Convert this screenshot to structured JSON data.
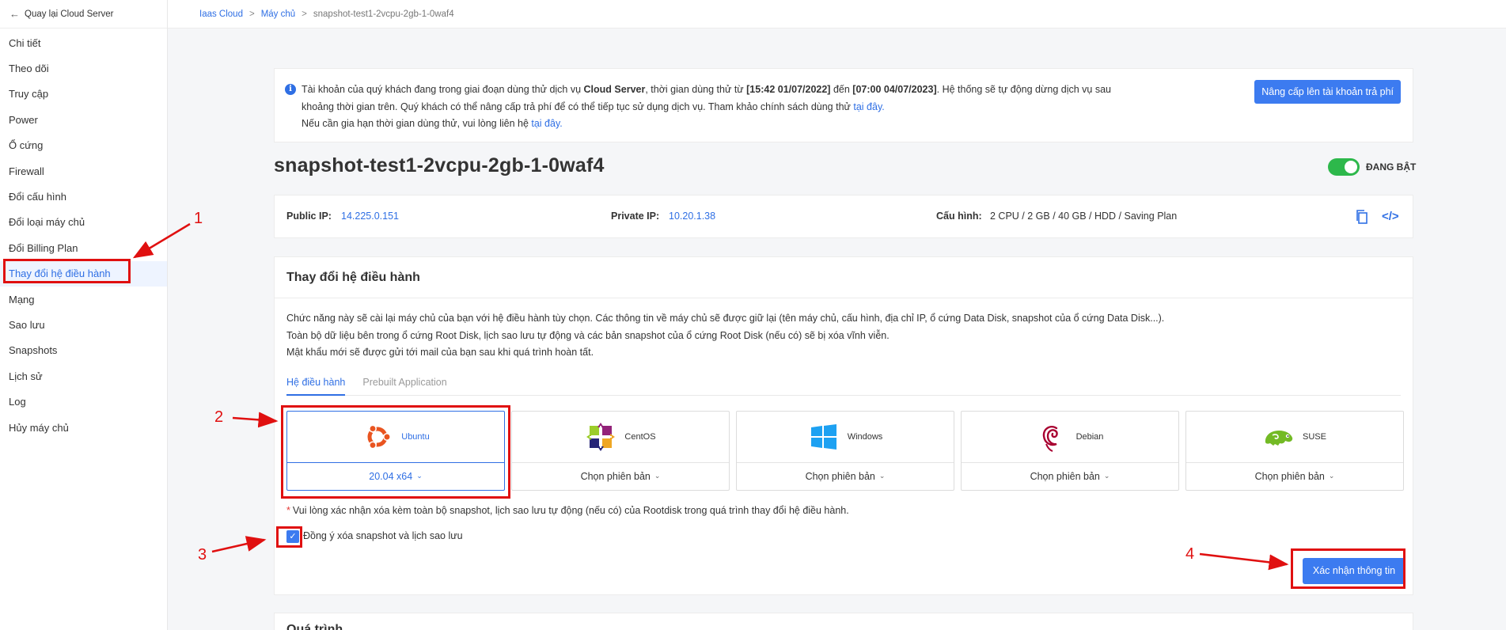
{
  "sidebar": {
    "back_label": "Quay lại Cloud Server",
    "items": [
      {
        "label": "Chi tiết"
      },
      {
        "label": "Theo dõi"
      },
      {
        "label": "Truy cập"
      },
      {
        "label": "Power"
      },
      {
        "label": "Ổ cứng"
      },
      {
        "label": "Firewall"
      },
      {
        "label": "Đổi cấu hình"
      },
      {
        "label": "Đổi loại máy chủ"
      },
      {
        "label": "Đổi Billing Plan"
      },
      {
        "label": "Thay đổi hệ điều hành"
      },
      {
        "label": "Mạng"
      },
      {
        "label": "Sao lưu"
      },
      {
        "label": "Snapshots"
      },
      {
        "label": "Lịch sử"
      },
      {
        "label": "Log"
      },
      {
        "label": "Hủy máy chủ"
      }
    ]
  },
  "breadcrumb": {
    "root": "Iaas Cloud",
    "sep": ">",
    "mid": "Máy chủ",
    "current": "snapshot-test1-2vcpu-2gb-1-0waf4"
  },
  "notice": {
    "t1": "Tài khoản của quý khách đang trong giai đoạn dùng thử dịch vụ ",
    "b1": "Cloud Server",
    "t2": ", thời gian dùng thử từ ",
    "b2": "[15:42 01/07/2022]",
    "t3": " đến ",
    "b3": "[07:00 04/07/2023]",
    "t4": ". Hệ thống sẽ tự động dừng dịch vụ sau",
    "t5": "khoảng thời gian trên. Quý khách có thể nâng cấp trả phí để có thể tiếp tục sử dụng dịch vụ. Tham khảo chính sách dùng thử ",
    "link1": "tại đây.",
    "t6": "Nếu cần gia hạn thời gian dùng thử, vui lòng liên hệ ",
    "link2": "tại đây.",
    "upgrade_label": "Nâng cấp lên tài khoản trả phí"
  },
  "server": {
    "name": "snapshot-test1-2vcpu-2gb-1-0waf4",
    "status": "ĐANG BẬT",
    "public_ip_label": "Public IP:",
    "public_ip": "14.225.0.151",
    "private_ip_label": "Private IP:",
    "private_ip": "10.20.1.38",
    "config_label": "Cấu hình:",
    "config": "2 CPU / 2 GB / 40 GB / HDD / Saving Plan"
  },
  "os_panel": {
    "title": "Thay đổi hệ điều hành",
    "desc1": "Chức năng này sẽ cài lại máy chủ của bạn với hệ điều hành tùy chọn. Các thông tin về máy chủ sẽ được giữ lại (tên máy chủ, cấu hình, địa chỉ IP, ổ cứng Data Disk, snapshot của ổ cứng Data Disk...).",
    "desc2": "Toàn bộ dữ liệu bên trong ổ cứng Root Disk, lịch sao lưu tự động và các bản snapshot của ổ cứng Root Disk (nếu có) sẽ bị xóa vĩnh viễn.",
    "desc3": "Mật khẩu mới sẽ được gửi tới mail của bạn sau khi quá trình hoàn tất.",
    "tabs": [
      "Hệ điều hành",
      "Prebuilt Application"
    ],
    "os_list": [
      {
        "name": "Ubuntu",
        "version": "20.04 x64"
      },
      {
        "name": "CentOS",
        "version": "Chọn phiên bản"
      },
      {
        "name": "Windows",
        "version": "Chọn phiên bản"
      },
      {
        "name": "Debian",
        "version": "Chọn phiên bản"
      },
      {
        "name": "SUSE",
        "version": "Chọn phiên bản"
      }
    ],
    "warning_star": "*",
    "warning": "Vui lòng xác nhận xóa kèm toàn bộ snapshot, lịch sao lưu tự động (nếu có) của Rootdisk trong quá trình thay đổi hệ điều hành.",
    "checkbox_label": "Đồng ý xóa snapshot và lịch sao lưu",
    "confirm_label": "Xác nhận thông tin"
  },
  "next_section_title": "Quá trình",
  "annotations": [
    "1",
    "2",
    "3",
    "4"
  ],
  "colors": {
    "accent": "#2f6fe4",
    "annotation": "#e01010",
    "toggle_on": "#2db84b"
  }
}
